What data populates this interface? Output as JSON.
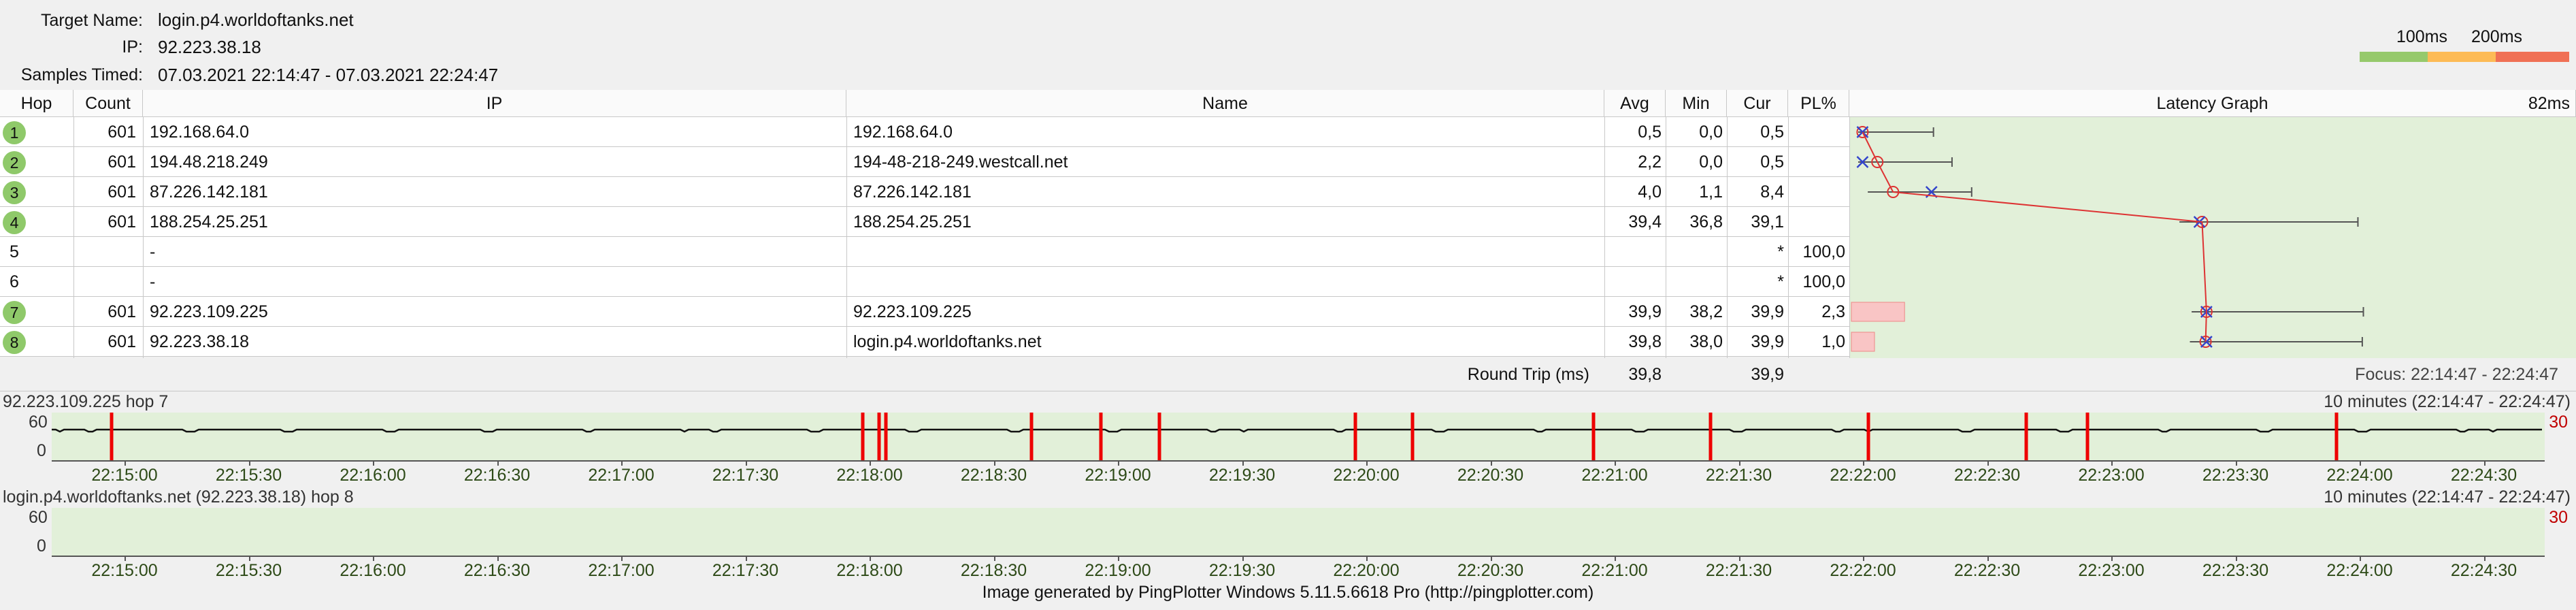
{
  "header": {
    "target_label": "Target Name:",
    "target_value": "login.p4.worldoftanks.net",
    "ip_label": "IP:",
    "ip_value": "92.223.38.18",
    "samples_label": "Samples Timed:",
    "samples_value": "07.03.2021 22:14:47 - 07.03.2021 22:24:47"
  },
  "legend": {
    "label_100": "100ms",
    "label_200": "200ms",
    "colors": [
      "#96c96c",
      "#fdbb56",
      "#f07055"
    ]
  },
  "table": {
    "headers": {
      "hop": "Hop",
      "count": "Count",
      "ip": "IP",
      "name": "Name",
      "avg": "Avg",
      "min": "Min",
      "cur": "Cur",
      "pl": "PL%",
      "graph": "Latency Graph",
      "graph_scale": "82ms"
    },
    "rows": [
      {
        "hop": "1",
        "count": "601",
        "ip": "192.168.64.0",
        "name": "192.168.64.0",
        "avg": "0,5",
        "min": "0,0",
        "cur": "0,5",
        "pl": "",
        "pl_star": "",
        "ok": true
      },
      {
        "hop": "2",
        "count": "601",
        "ip": "194.48.218.249",
        "name": "194-48-218-249.westcall.net",
        "avg": "2,2",
        "min": "0,0",
        "cur": "0,5",
        "pl": "",
        "pl_star": "",
        "ok": true
      },
      {
        "hop": "3",
        "count": "601",
        "ip": "87.226.142.181",
        "name": "87.226.142.181",
        "avg": "4,0",
        "min": "1,1",
        "cur": "8,4",
        "pl": "",
        "pl_star": "",
        "ok": true
      },
      {
        "hop": "4",
        "count": "601",
        "ip": "188.254.25.251",
        "name": "188.254.25.251",
        "avg": "39,4",
        "min": "36,8",
        "cur": "39,1",
        "pl": "",
        "pl_star": "",
        "ok": true
      },
      {
        "hop": "5",
        "count": "",
        "ip": "-",
        "name": "",
        "avg": "",
        "min": "",
        "cur": "",
        "pl": "100,0",
        "pl_star": "*",
        "ok": false
      },
      {
        "hop": "6",
        "count": "",
        "ip": "-",
        "name": "",
        "avg": "",
        "min": "",
        "cur": "",
        "pl": "100,0",
        "pl_star": "*",
        "ok": false
      },
      {
        "hop": "7",
        "count": "601",
        "ip": "92.223.109.225",
        "name": "92.223.109.225",
        "avg": "39,9",
        "min": "38,2",
        "cur": "39,9",
        "pl": "2,3",
        "pl_star": "",
        "ok": true
      },
      {
        "hop": "8",
        "count": "601",
        "ip": "92.223.38.18",
        "name": "login.p4.worldoftanks.net",
        "avg": "39,8",
        "min": "38,0",
        "cur": "39,9",
        "pl": "1,0",
        "pl_star": "",
        "ok": true
      }
    ],
    "round_trip": {
      "label": "Round Trip (ms)",
      "avg": "39,8",
      "cur": "39,9",
      "focus": "Focus: 22:14:47 - 22:24:47"
    }
  },
  "timeline1": {
    "title": "92.223.109.225 hop 7",
    "range": "10 minutes (22:14:47 - 22:24:47)",
    "y_top": "60",
    "y_bottom": "0",
    "right_label": "30"
  },
  "timeline2": {
    "title": "login.p4.worldoftanks.net (92.223.38.18) hop 8",
    "range": "10 minutes (22:14:47 - 22:24:47)",
    "y_top": "60",
    "y_bottom": "0",
    "right_label": "30"
  },
  "time_ticks": [
    "22:15:00",
    "22:15:30",
    "22:16:00",
    "22:16:30",
    "22:17:00",
    "22:17:30",
    "22:18:00",
    "22:18:30",
    "22:19:00",
    "22:19:30",
    "22:20:00",
    "22:20:30",
    "22:21:00",
    "22:21:30",
    "22:22:00",
    "22:22:30",
    "22:23:00",
    "22:23:30",
    "22:24:00",
    "22:24:30"
  ],
  "footer": "Image generated by PingPlotter Windows 5.11.5.6618 Pro (http://pingplotter.com)"
}
